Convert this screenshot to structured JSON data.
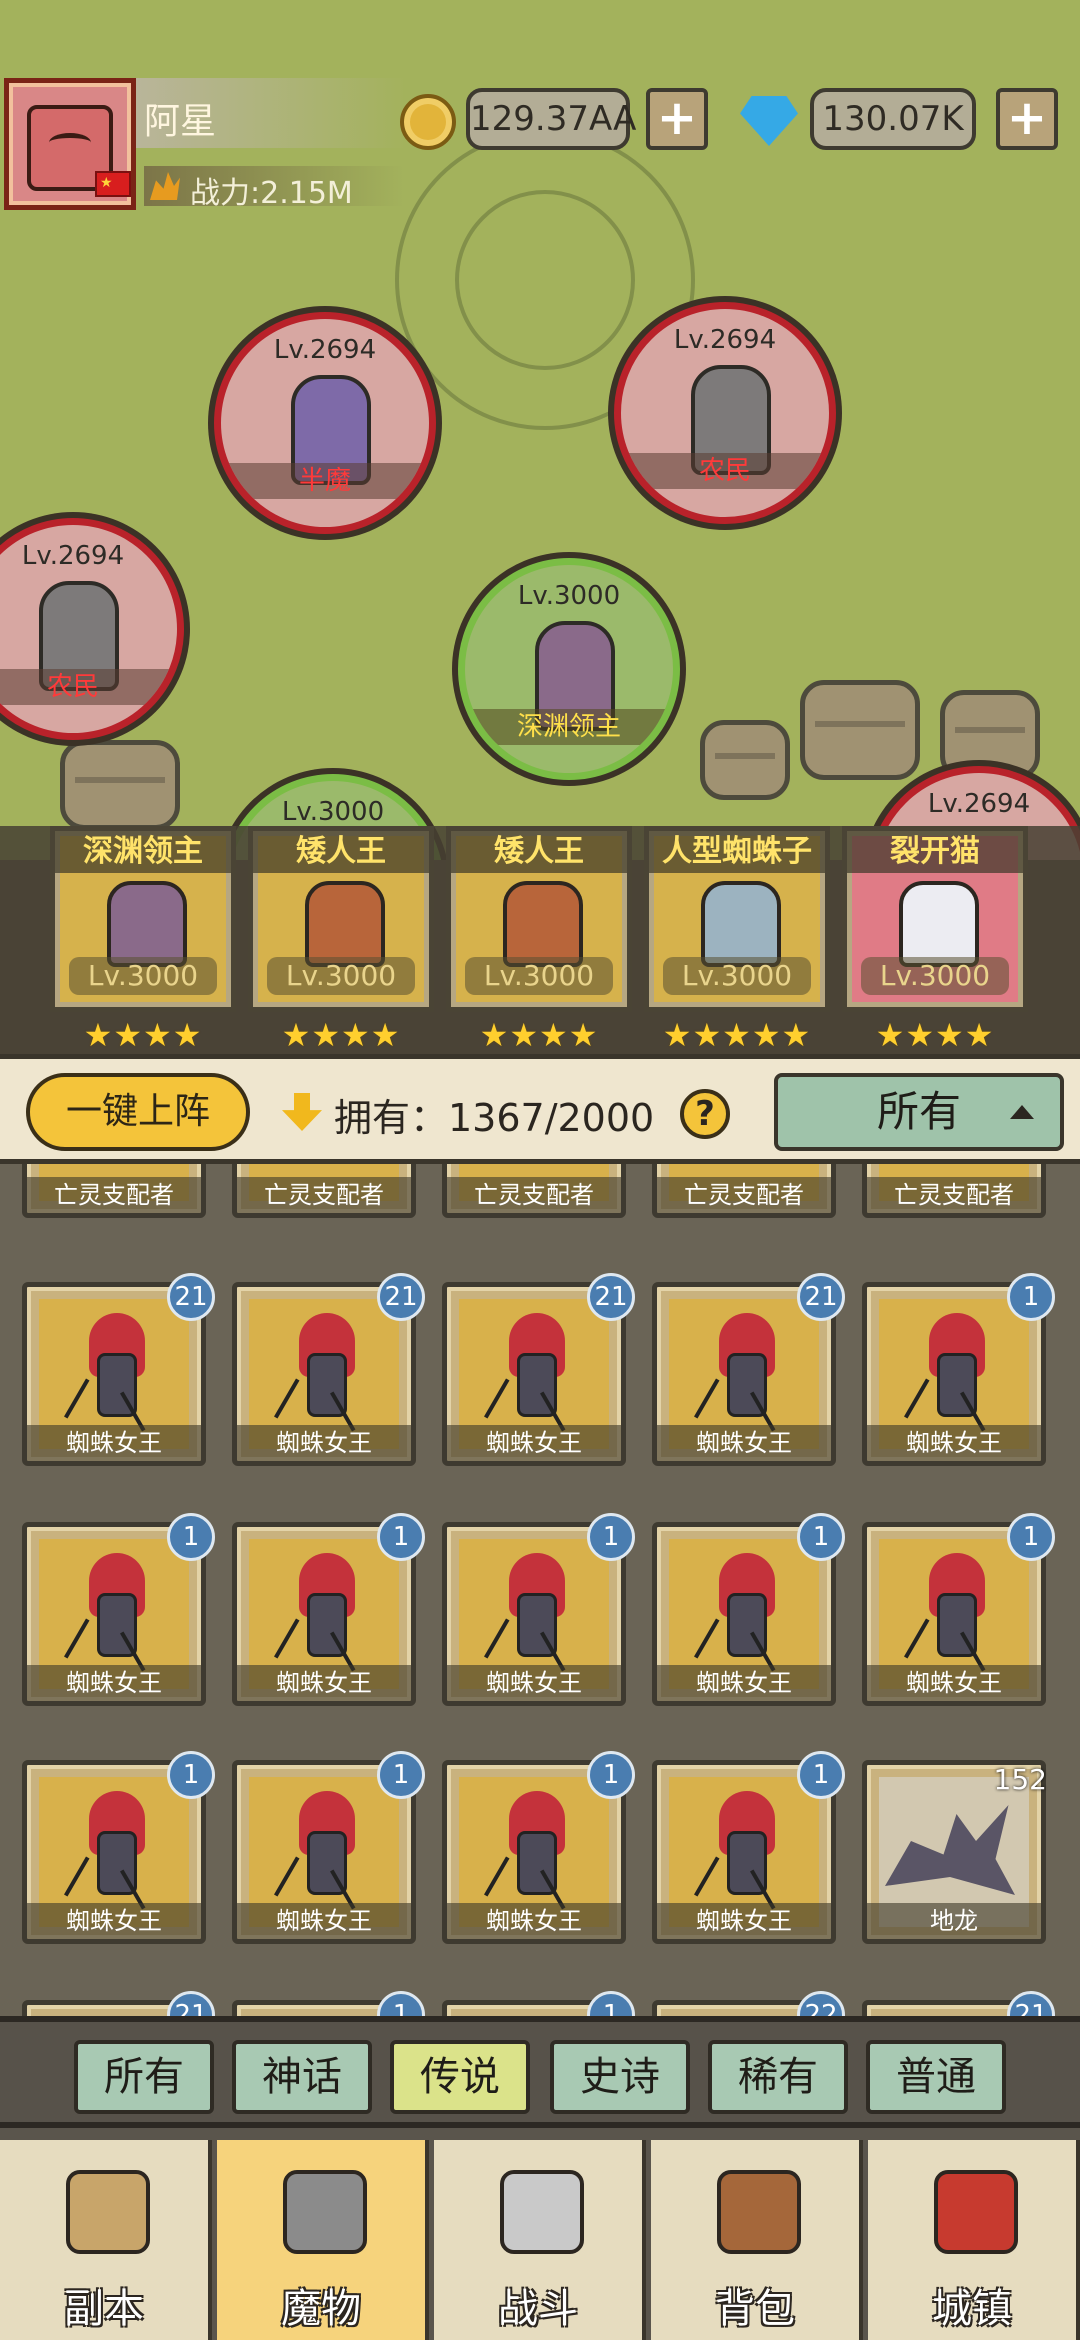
{
  "player": {
    "name": "阿星",
    "power": "战力:2.15M"
  },
  "currency": {
    "gold": "129.37AA",
    "gems": "130.07K",
    "plus": "+"
  },
  "map_units": [
    {
      "level": "Lv.2694",
      "name": "半魔",
      "kind": "enemy"
    },
    {
      "level": "Lv.2694",
      "name": "农民",
      "kind": "enemy"
    },
    {
      "level": "Lv.2694",
      "name": "农民",
      "kind": "enemy"
    },
    {
      "level": "Lv.3000",
      "name": "深渊领主",
      "kind": "boss"
    },
    {
      "level": "Lv.3000",
      "name": "",
      "kind": "boss"
    },
    {
      "level": "Lv.2694",
      "name": "",
      "kind": "enemy"
    }
  ],
  "team": [
    {
      "name": "深渊领主",
      "level": "Lv.3000",
      "stars": "★★★★"
    },
    {
      "name": "矮人王",
      "level": "Lv.3000",
      "stars": "★★★★"
    },
    {
      "name": "矮人王",
      "level": "Lv.3000",
      "stars": "★★★★"
    },
    {
      "name": "人型蜘蛛子",
      "level": "Lv.3000",
      "stars": "★★★★★"
    },
    {
      "name": "裂开猫",
      "level": "Lv.3000",
      "stars": "★★★★"
    }
  ],
  "controls": {
    "deploy": "一键上阵",
    "owned": "拥有：1367/2000",
    "help": "?",
    "filter": "所有"
  },
  "grid": {
    "partial_top": [
      "亡灵支配者",
      "亡灵支配者",
      "亡灵支配者",
      "亡灵支配者",
      "亡灵支配者"
    ],
    "rows": [
      [
        {
          "name": "蜘蛛女王",
          "count": "21"
        },
        {
          "name": "蜘蛛女王",
          "count": "21"
        },
        {
          "name": "蜘蛛女王",
          "count": "21"
        },
        {
          "name": "蜘蛛女王",
          "count": "21"
        },
        {
          "name": "蜘蛛女王",
          "count": "1"
        }
      ],
      [
        {
          "name": "蜘蛛女王",
          "count": "1"
        },
        {
          "name": "蜘蛛女王",
          "count": "1"
        },
        {
          "name": "蜘蛛女王",
          "count": "1"
        },
        {
          "name": "蜘蛛女王",
          "count": "1"
        },
        {
          "name": "蜘蛛女王",
          "count": "1"
        }
      ],
      [
        {
          "name": "蜘蛛女王",
          "count": "1"
        },
        {
          "name": "蜘蛛女王",
          "count": "1"
        },
        {
          "name": "蜘蛛女王",
          "count": "1"
        },
        {
          "name": "蜘蛛女王",
          "count": "1"
        },
        {
          "name": "地龙",
          "count": "152"
        }
      ]
    ],
    "partial_bottom_counts": [
      "21",
      "1",
      "1",
      "22",
      "21"
    ]
  },
  "rarity_tabs": [
    "所有",
    "神话",
    "传说",
    "史诗",
    "稀有",
    "普通"
  ],
  "rarity_active": "传说",
  "bottom_nav": [
    "副本",
    "魔物",
    "战斗",
    "背包",
    "城镇"
  ],
  "bottom_nav_active": "魔物"
}
